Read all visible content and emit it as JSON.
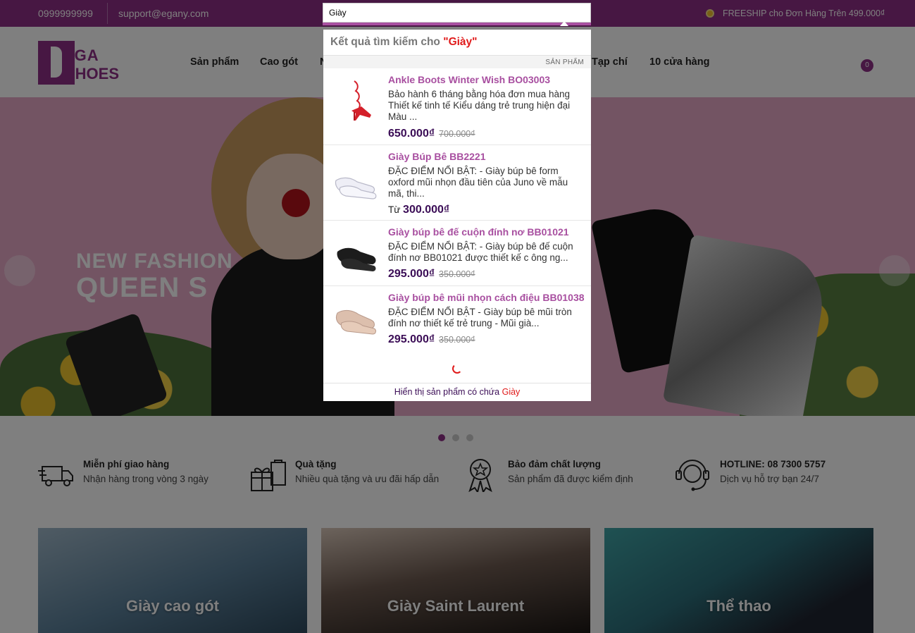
{
  "topbar": {
    "phone": "0999999999",
    "email": "support@egany.com",
    "shipping": "FREESHIP cho Đơn Hàng Trên 499.000₫"
  },
  "header": {
    "logo_line1": "EGA",
    "logo_line2": "SHOES",
    "nav": [
      "Sản phẩm",
      "Cao gót",
      "Tạp chí",
      "10 cửa hàng"
    ],
    "nav_partial": "N",
    "cart_count": "0"
  },
  "hero": {
    "line1": "NEW FASHION",
    "line2": "QUEEN S",
    "slide_count": 3,
    "active_slide": 1
  },
  "services": [
    {
      "title": "Miễn phí giao hàng",
      "desc": "Nhận hàng trong vòng 3 ngày",
      "icon": "truck-icon"
    },
    {
      "title": "Quà tặng",
      "desc": "Nhiều quà tặng và ưu đãi hấp dẫn",
      "icon": "gift-icon"
    },
    {
      "title": "Bảo đảm chất lượng",
      "desc": "Sản phẩm đã được kiểm định",
      "icon": "quality-badge-icon"
    },
    {
      "title": "HOTLINE: 08 7300 5757",
      "desc": "Dịch vụ hỗ trợ bạn 24/7",
      "icon": "headset-icon"
    }
  ],
  "categories": [
    "Giày cao gót",
    "Giày Saint Laurent",
    "Thể thao"
  ],
  "search": {
    "value": "Giày",
    "heading": "Kết quả tìm kiếm cho",
    "query_display": "\"Giày\"",
    "section_label": "SẢN PHẨM",
    "results": [
      {
        "name": "Ankle Boots Winter Wish BO03003",
        "desc": "Bảo hành 6 tháng bằng hóa đơn mua hàng Thiết kế tinh tế Kiểu dáng trẻ trung hiện đại Màu ...",
        "prefix": "",
        "price": "650.000₫",
        "old_price": "700.000₫",
        "color": "#d4202a"
      },
      {
        "name": "Giày Búp Bê BB2221",
        "desc": "ĐẶC ĐIỂM NỔI BẬT: - Giày búp bê form oxford mũi nhọn đầu tiên của Juno về mẫu mã, thi...",
        "prefix": "Từ ",
        "price": "300.000₫",
        "old_price": "",
        "color": "#e8e8f2"
      },
      {
        "name": "Giày búp bê đế cuộn đính nơ BB01021",
        "desc": "ĐẶC ĐIỂM NỔI BẬT: - Giày búp bê đế cuộn đính nơ BB01021 được thiết kế c ông ng...",
        "prefix": "",
        "price": "295.000₫",
        "old_price": "350.000₫",
        "color": "#1c1c1c"
      },
      {
        "name": "Giày búp bê mũi nhọn cách điệu BB01038",
        "desc": "ĐẶC ĐIỂM NỔI BẬT - Giày búp bê mũi tròn đính nơ thiết kế trẻ trung - Mũi già...",
        "prefix": "",
        "price": "295.000₫",
        "old_price": "350.000₫",
        "color": "#d8b8a4"
      }
    ],
    "footer_text": "Hiển thị sản phẩm có chứa ",
    "footer_query": "Giày"
  },
  "colors": {
    "brand": "#8e2f86",
    "accent": "#a84fa0",
    "price": "#3b0d56",
    "query": "#e01a1a"
  }
}
